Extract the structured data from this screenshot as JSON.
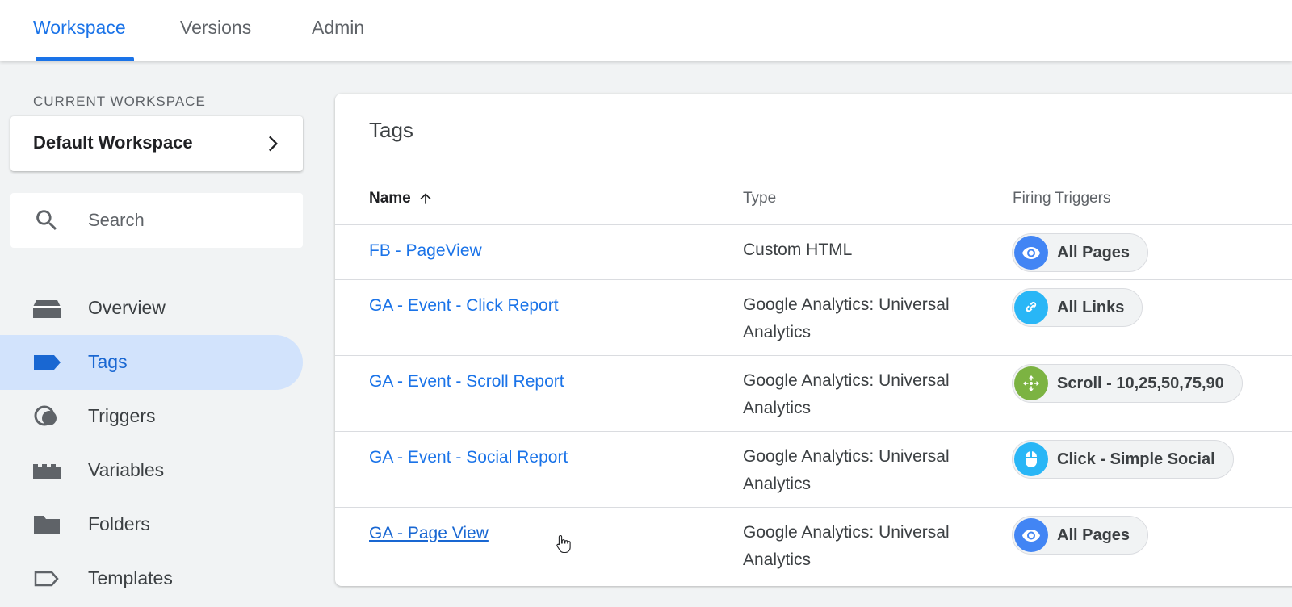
{
  "topnav": {
    "tabs": [
      {
        "label": "Workspace",
        "active": true
      },
      {
        "label": "Versions"
      },
      {
        "label": "Admin"
      }
    ]
  },
  "sidebar": {
    "workspace_caption": "CURRENT WORKSPACE",
    "workspace_name": "Default Workspace",
    "search_placeholder": "Search",
    "items": [
      {
        "label": "Overview",
        "icon": "overview-icon"
      },
      {
        "label": "Tags",
        "icon": "tag-icon",
        "active": true
      },
      {
        "label": "Triggers",
        "icon": "trigger-icon"
      },
      {
        "label": "Variables",
        "icon": "variables-icon"
      },
      {
        "label": "Folders",
        "icon": "folder-icon"
      },
      {
        "label": "Templates",
        "icon": "template-icon"
      }
    ]
  },
  "main": {
    "title": "Tags",
    "columns": {
      "name": "Name",
      "type": "Type",
      "triggers": "Firing Triggers"
    },
    "rows": [
      {
        "name": "FB - PageView",
        "type": "Custom HTML",
        "trigger": "All Pages",
        "trigger_icon": "eye-icon",
        "trigger_color": "#4285f4"
      },
      {
        "name": "GA - Event - Click Report",
        "type": "Google Analytics: Universal Analytics",
        "trigger": "All Links",
        "trigger_icon": "link-icon",
        "trigger_color": "#29b6f6"
      },
      {
        "name": "GA - Event - Scroll Report",
        "type": "Google Analytics: Universal Analytics",
        "trigger": "Scroll - 10,25,50,75,90",
        "trigger_icon": "scroll-icon",
        "trigger_color": "#7cb342"
      },
      {
        "name": "GA - Event - Social Report",
        "type": "Google Analytics: Universal Analytics",
        "trigger": "Click - Simple Social",
        "trigger_icon": "mouse-icon",
        "trigger_color": "#29b6f6"
      },
      {
        "name": "GA - Page View",
        "type": "Google Analytics: Universal Analytics",
        "trigger": "All Pages",
        "trigger_icon": "eye-icon",
        "trigger_color": "#4285f4"
      }
    ]
  }
}
